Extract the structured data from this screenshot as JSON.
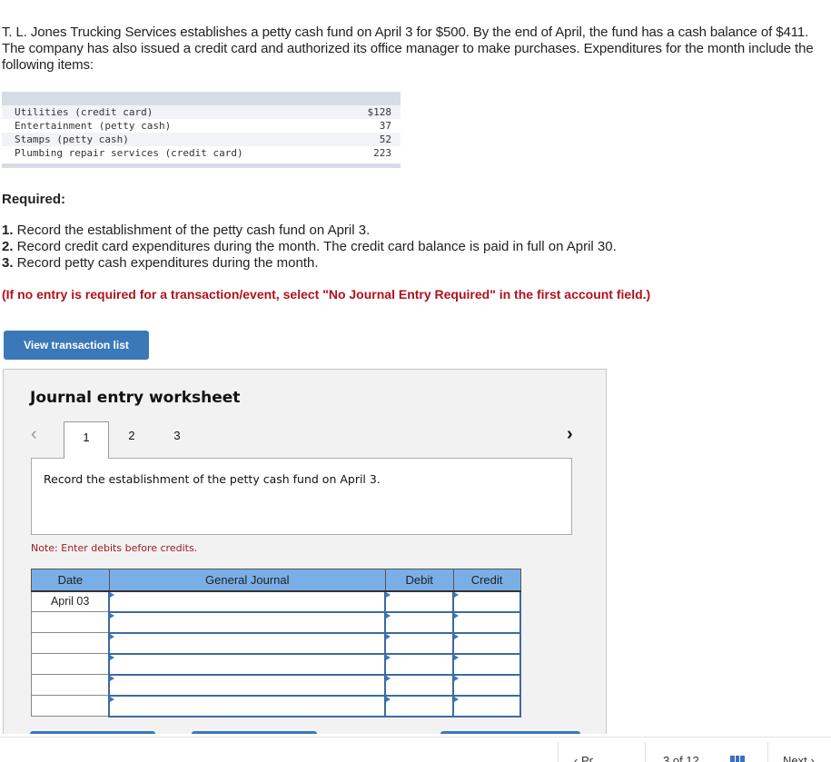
{
  "problem": {
    "intro": "T. L. Jones Trucking Services establishes a petty cash fund on April 3 for $500. By the end of April, the fund has a cash balance of $411. The company has also issued a credit card and authorized its office manager to make purchases. Expenditures for the month include the following items:",
    "expenditures": [
      {
        "item": "Utilities (credit card)",
        "amount": "$128"
      },
      {
        "item": "Entertainment (petty cash)",
        "amount": "37"
      },
      {
        "item": "Stamps (petty cash)",
        "amount": "52"
      },
      {
        "item": "Plumbing repair services (credit card)",
        "amount": "223"
      }
    ],
    "required_label": "Required:",
    "requirements": [
      {
        "num": "1.",
        "text": " Record the establishment of the petty cash fund on April 3."
      },
      {
        "num": "2.",
        "text": " Record credit card expenditures during the month. The credit card balance is paid in full on April 30."
      },
      {
        "num": "3.",
        "text": " Record petty cash expenditures during the month."
      }
    ],
    "note": "(If no entry is required for a transaction/event, select \"No Journal Entry Required\" in the first account field.)"
  },
  "view_transaction_button": "View transaction list",
  "worksheet": {
    "title": "Journal entry worksheet",
    "prev_icon": "‹",
    "next_icon": "›",
    "tabs": [
      "1",
      "2",
      "3"
    ],
    "active_tab": "1",
    "description": "Record the establishment of the petty cash fund on April 3.",
    "note": "Note: Enter debits before credits.",
    "table": {
      "headers": [
        "Date",
        "General Journal",
        "Debit",
        "Credit"
      ],
      "rows": [
        {
          "date": "April 03",
          "account": "",
          "debit": "",
          "credit": ""
        },
        {
          "date": "",
          "account": "",
          "debit": "",
          "credit": ""
        },
        {
          "date": "",
          "account": "",
          "debit": "",
          "credit": ""
        },
        {
          "date": "",
          "account": "",
          "debit": "",
          "credit": ""
        },
        {
          "date": "",
          "account": "",
          "debit": "",
          "credit": ""
        },
        {
          "date": "",
          "account": "",
          "debit": "",
          "credit": ""
        }
      ]
    }
  },
  "footer": {
    "prev_label": "‹ Pr",
    "page_label": "3 of 12",
    "next_label": "Next ›"
  },
  "colors": {
    "accent_blue": "#3b78b8",
    "header_blue": "#7aaee6",
    "note_red": "#b0121c"
  }
}
